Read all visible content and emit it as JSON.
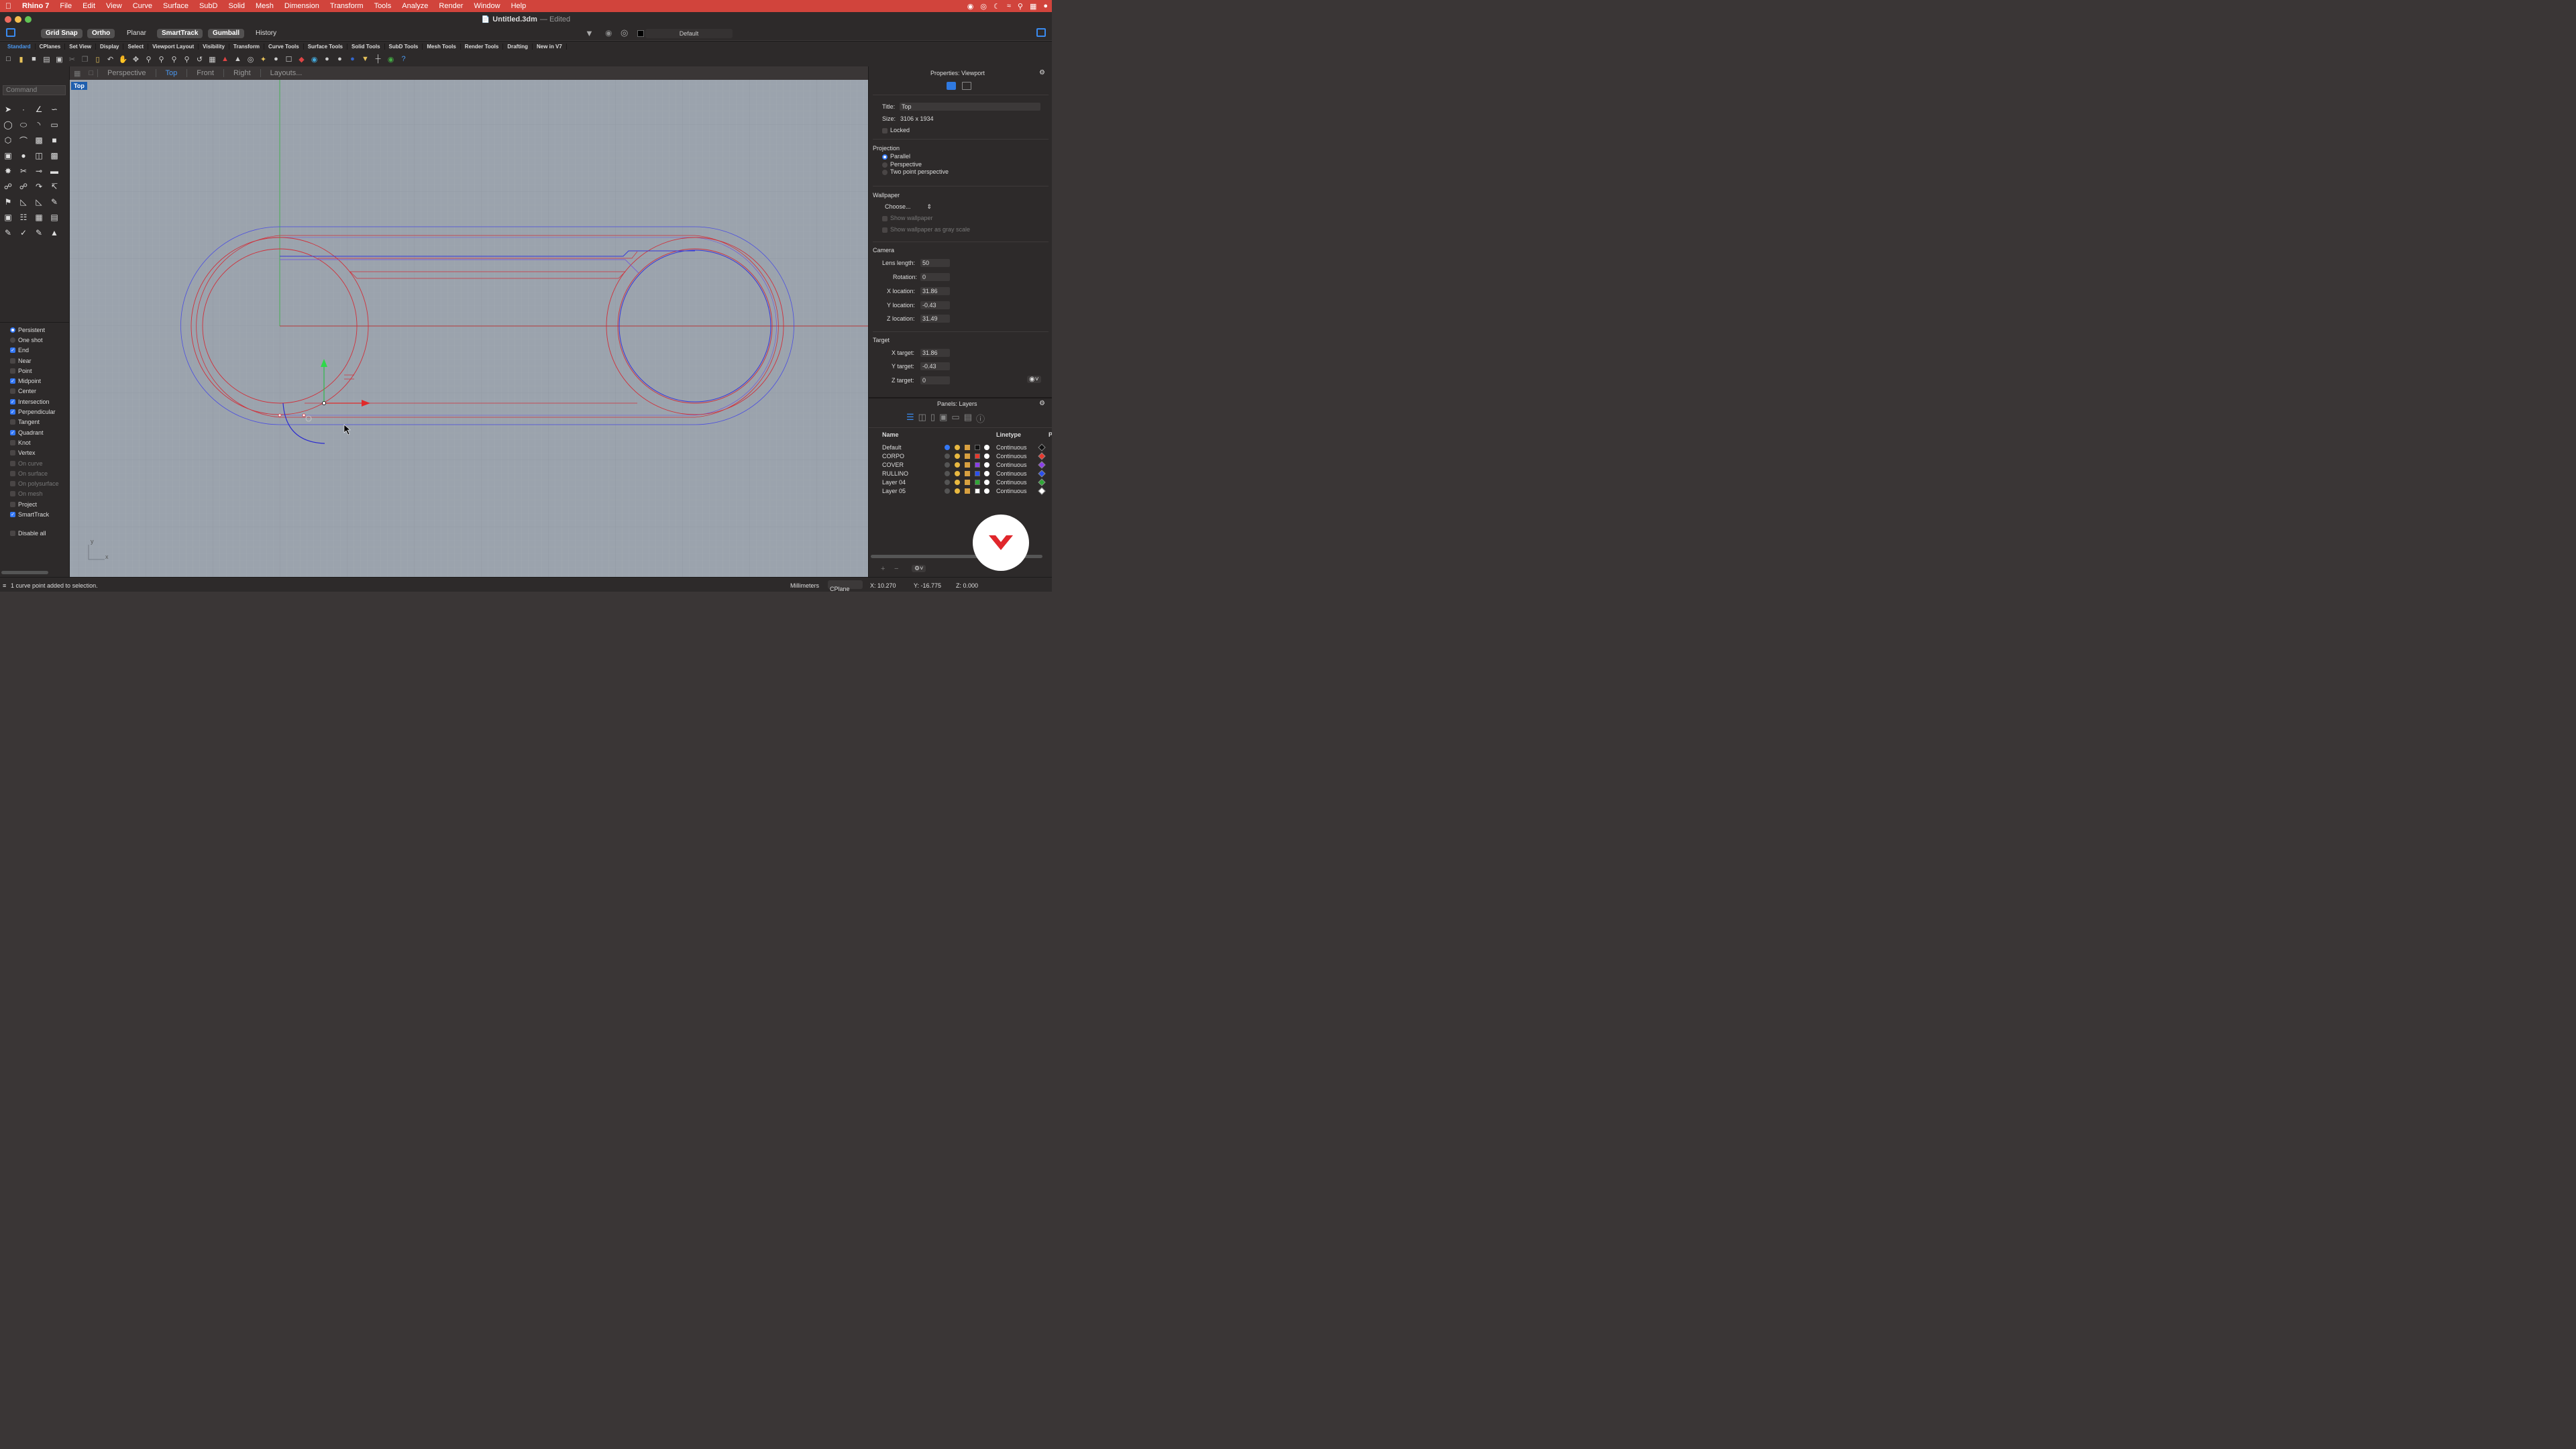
{
  "menubar": {
    "app": "Rhino 7",
    "items": [
      "File",
      "Edit",
      "View",
      "Curve",
      "Surface",
      "SubD",
      "Solid",
      "Mesh",
      "Dimension",
      "Transform",
      "Tools",
      "Analyze",
      "Render",
      "Window",
      "Help"
    ]
  },
  "titlebar": {
    "filename": "Untitled.3dm",
    "state": "— Edited"
  },
  "toprow": {
    "modes": [
      "Grid Snap",
      "Ortho",
      "Planar",
      "SmartTrack",
      "Gumball",
      "History"
    ],
    "layer": "Default"
  },
  "tabs": [
    "Standard",
    "CPlanes",
    "Set View",
    "Display",
    "Select",
    "Viewport Layout",
    "Visibility",
    "Transform",
    "Curve Tools",
    "Surface Tools",
    "Solid Tools",
    "SubD Tools",
    "Mesh Tools",
    "Render Tools",
    "Drafting",
    "New in V7"
  ],
  "command": {
    "placeholder": "Command"
  },
  "viewport_tabs": [
    "Perspective",
    "Top",
    "Front",
    "Right",
    "Layouts..."
  ],
  "viewport": {
    "label": "Top",
    "axis_x": "x",
    "axis_y": "y"
  },
  "osnaps": {
    "persistent": "Persistent",
    "oneshot": "One shot",
    "items": [
      {
        "label": "End",
        "on": true
      },
      {
        "label": "Near",
        "on": false
      },
      {
        "label": "Point",
        "on": false
      },
      {
        "label": "Midpoint",
        "on": true
      },
      {
        "label": "Center",
        "on": false
      },
      {
        "label": "Intersection",
        "on": true
      },
      {
        "label": "Perpendicular",
        "on": true
      },
      {
        "label": "Tangent",
        "on": false
      },
      {
        "label": "Quadrant",
        "on": true
      },
      {
        "label": "Knot",
        "on": false
      },
      {
        "label": "Vertex",
        "on": false
      },
      {
        "label": "On curve",
        "on": false,
        "disabled": true
      },
      {
        "label": "On surface",
        "on": false,
        "disabled": true
      },
      {
        "label": "On polysurface",
        "on": false,
        "disabled": true
      },
      {
        "label": "On mesh",
        "on": false,
        "disabled": true
      },
      {
        "label": "Project",
        "on": false
      },
      {
        "label": "SmartTrack",
        "on": true
      }
    ],
    "disable_all": "Disable all"
  },
  "properties": {
    "header": "Properties: Viewport",
    "title_label": "Title:",
    "title_value": "Top",
    "size_label": "Size:",
    "size_value": "3106 x 1934",
    "locked": "Locked",
    "projection": "Projection",
    "proj_options": [
      "Parallel",
      "Perspective",
      "Two point perspective"
    ],
    "wallpaper": "Wallpaper",
    "choose": "Choose...",
    "show_wallpaper": "Show wallpaper",
    "show_gray": "Show wallpaper as gray scale",
    "camera": "Camera",
    "lens_label": "Lens length:",
    "lens": "50",
    "rotation_label": "Rotation:",
    "rotation": "0",
    "xloc_label": "X location:",
    "xloc": "31.86",
    "yloc_label": "Y location:",
    "yloc": "-0.43",
    "zloc_label": "Z location:",
    "zloc": "31.49",
    "target": "Target",
    "xt_label": "X target:",
    "xt": "31.86",
    "yt_label": "Y target:",
    "yt": "-0.43",
    "zt_label": "Z target:",
    "zt": "0"
  },
  "layers": {
    "header": "Panels: Layers",
    "col_name": "Name",
    "col_linetype": "Linetype",
    "col_p": "P",
    "rows": [
      {
        "name": "Default",
        "color": "#111111",
        "linetype": "Continuous",
        "current": true
      },
      {
        "name": "CORPO",
        "color": "#e8382d",
        "linetype": "Continuous"
      },
      {
        "name": "COVER",
        "color": "#8a3de8",
        "linetype": "Continuous"
      },
      {
        "name": "RULLINO",
        "color": "#2a4ff0",
        "linetype": "Continuous"
      },
      {
        "name": "Layer 04",
        "color": "#2fa836",
        "linetype": "Continuous"
      },
      {
        "name": "Layer 05",
        "color": "#ffffff",
        "linetype": "Continuous"
      }
    ]
  },
  "status": {
    "message": "1 curve point added to selection.",
    "units": "Millimeters",
    "cplane": "CPlane",
    "x": "X: 10.270",
    "y": "Y: -16.775",
    "z": "Z: 0.000"
  },
  "colors": {
    "accent": "#3478f6",
    "menubar": "#d1443c",
    "curve_red": "#d0303a",
    "curve_blue": "#3535d8",
    "viewport_bg": "#9ba3ad"
  }
}
